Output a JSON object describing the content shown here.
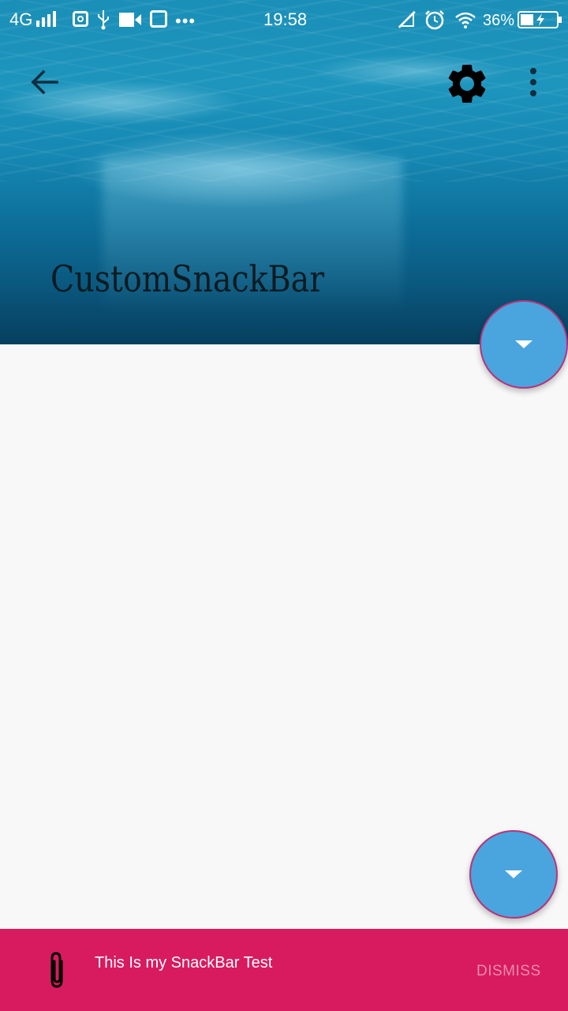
{
  "status_bar": {
    "network": "4G",
    "time": "19:58",
    "battery": "36%",
    "more": "•••",
    "icons": [
      "signal-icon",
      "instagram-icon",
      "usb-icon",
      "video-icon",
      "app-icon",
      "mute-icon",
      "alarm-icon",
      "wifi-icon",
      "battery-icon"
    ]
  },
  "toolbar": {
    "title": "CustomSnackBar",
    "icons": [
      "back-arrow-icon",
      "gear-icon",
      "more-vert-icon"
    ]
  },
  "fabs": [
    {
      "icon": "arrow-drop-down-icon",
      "color": "#4aa5de"
    },
    {
      "icon": "arrow-drop-down-icon",
      "color": "#4aa5de"
    }
  ],
  "snackbar": {
    "message": "This Is my SnackBar Test",
    "action": "DISMISS",
    "icon": "paperclip-icon",
    "color": "#d81b5e"
  }
}
